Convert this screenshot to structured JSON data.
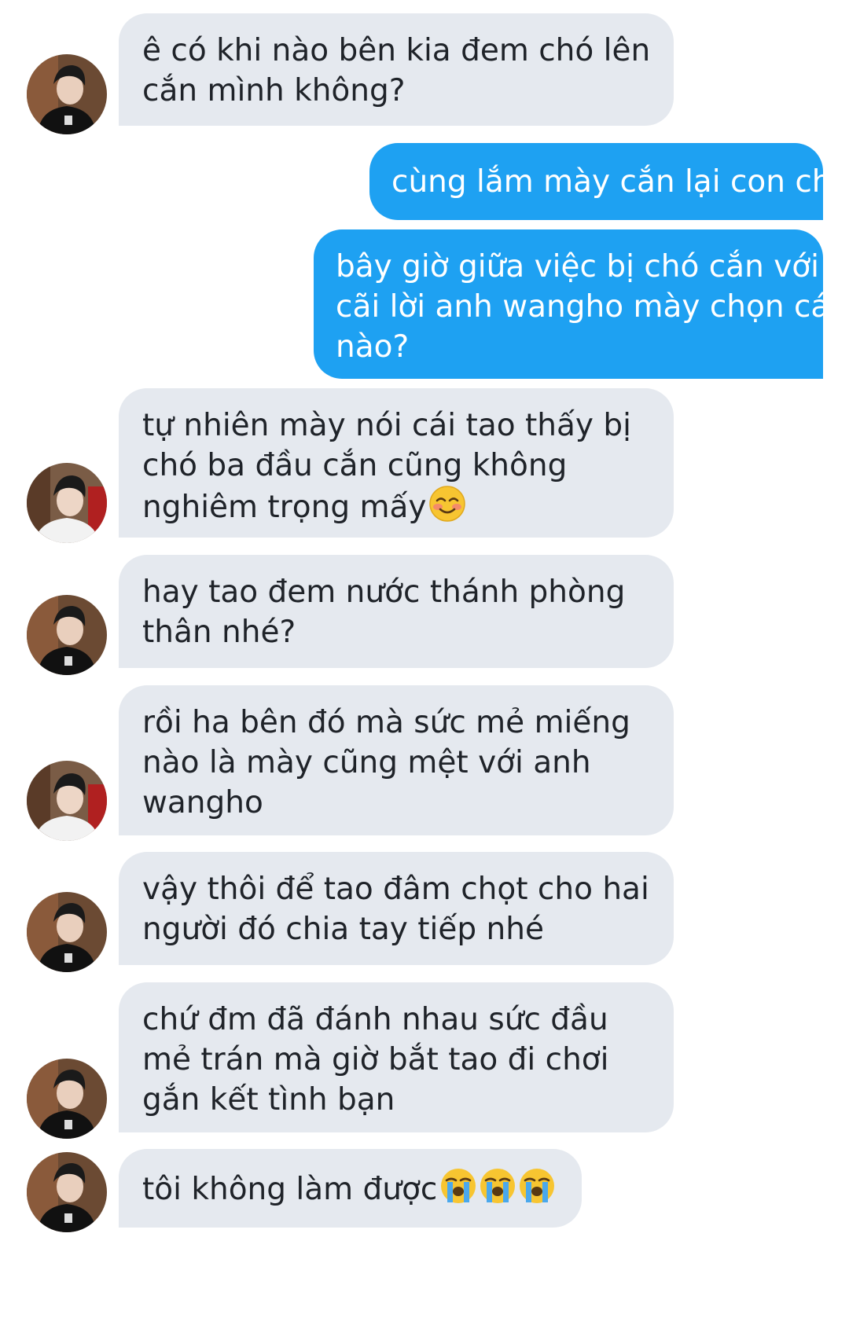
{
  "conversation": {
    "messages": [
      {
        "sender": "other",
        "lines": [
          "ê có khi nào bên kia đem chó lên",
          "cắn mình không?"
        ]
      },
      {
        "sender": "me",
        "lines": [
          "cùng lắm mày cắn lại con chó"
        ]
      },
      {
        "sender": "me",
        "lines": [
          "bây giờ giữa việc bị chó cắn với",
          "cãi lời anh wangho mày chọn cái",
          "nào?"
        ]
      },
      {
        "sender": "other",
        "lines": [
          "tự nhiên mày nói cái tao thấy bị",
          "chó ba đầu cắn cũng không",
          "nghiêm trọng mấy"
        ],
        "emoji": [
          "smiling-blush-emoji"
        ]
      },
      {
        "sender": "other",
        "lines": [
          "hay tao đem nước thánh phòng",
          "thân nhé?"
        ]
      },
      {
        "sender": "other",
        "lines": [
          "rồi ha bên đó mà sức mẻ miếng",
          "nào là mày cũng mệt với anh",
          "wangho"
        ]
      },
      {
        "sender": "other",
        "lines": [
          "vậy thôi để tao đâm chọt cho hai",
          "người đó chia tay tiếp nhé"
        ]
      },
      {
        "sender": "other",
        "lines": [
          "chứ đm đã đánh nhau sức đầu",
          "mẻ trán mà giờ bắt tao đi chơi",
          "gắn kết tình bạn"
        ]
      },
      {
        "sender": "other",
        "lines": [
          "tôi không làm được"
        ],
        "emoji": [
          "loudly-crying-emoji",
          "loudly-crying-emoji",
          "loudly-crying-emoji"
        ]
      }
    ]
  },
  "colors": {
    "incoming_bubble": "#e5e9ef",
    "incoming_text": "#1f2329",
    "outgoing_bubble": "#1ea1f2",
    "outgoing_text": "#ffffff",
    "background": "#ffffff"
  },
  "icons": {
    "avatar_dark": "person-avatar-dark-shirt",
    "avatar_light": "person-avatar-white-shirt"
  }
}
